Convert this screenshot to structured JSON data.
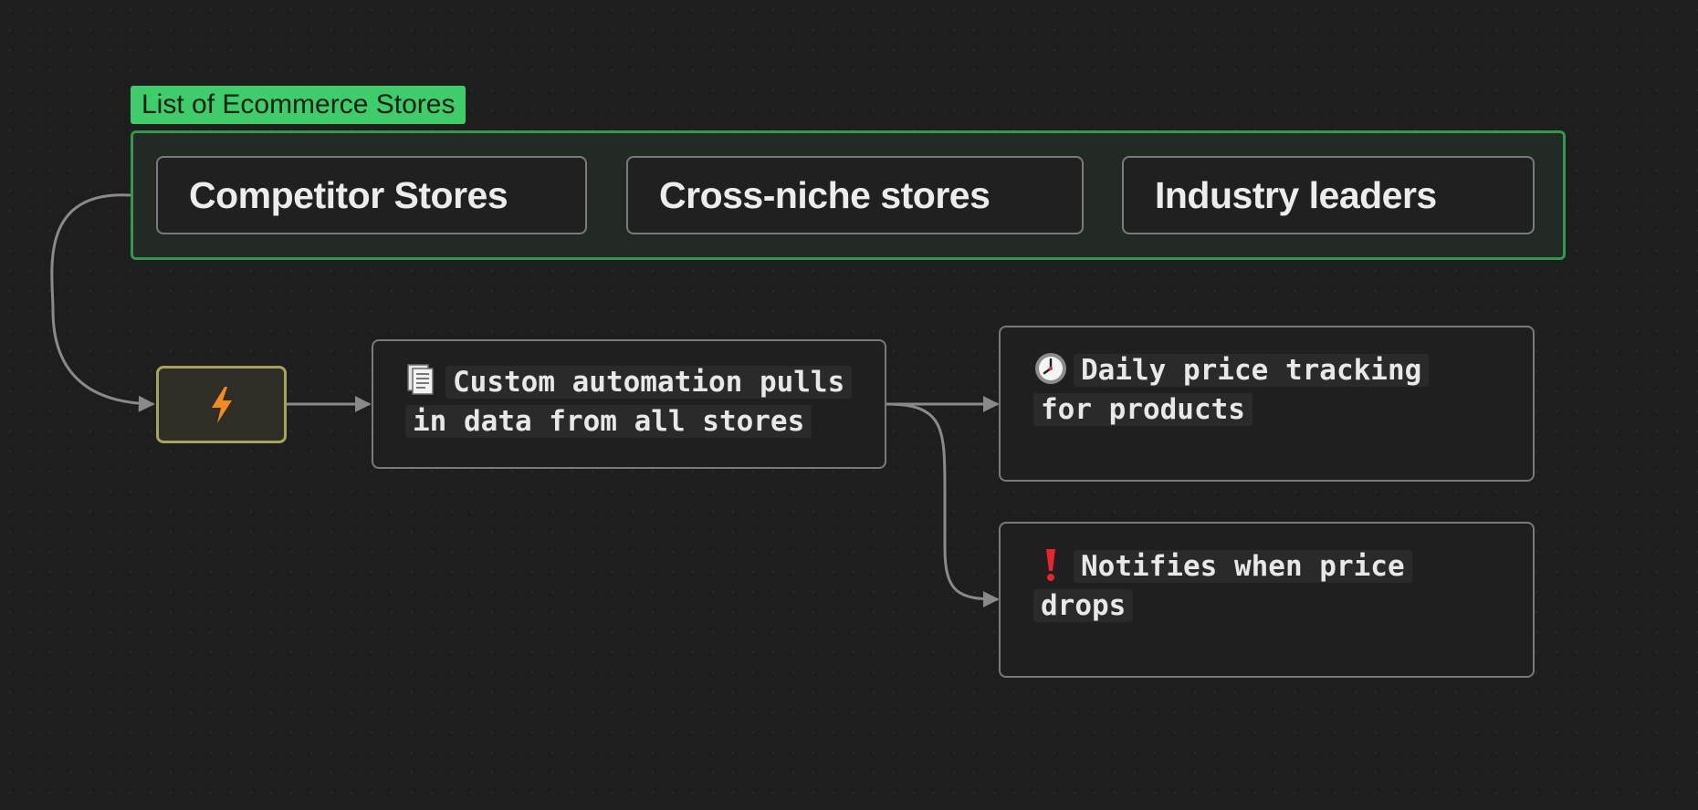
{
  "group": {
    "label": "List of Ecommerce Stores",
    "stores": [
      {
        "label": "Competitor Stores"
      },
      {
        "label": "Cross-niche stores"
      },
      {
        "label": "Industry leaders"
      }
    ]
  },
  "trigger": {
    "icon": "lightning-bolt-icon",
    "color": "#f08a24"
  },
  "automation": {
    "icon": "document-pages-icon",
    "line1": "Custom automation pulls",
    "line2": "in data from all stores"
  },
  "tracking": {
    "icon": "clock-icon",
    "line1": "Daily price tracking",
    "line2": "for products"
  },
  "notify": {
    "icon": "exclamation-icon",
    "line1": "Notifies when price",
    "line2": "drops"
  },
  "colors": {
    "canvas": "#1e1e1e",
    "group_accent": "#3fcd6b",
    "group_border": "#2f9a4c",
    "trigger_border": "#a8a35c",
    "node_border": "#7a7a7a",
    "connector": "#8a8a8a"
  }
}
